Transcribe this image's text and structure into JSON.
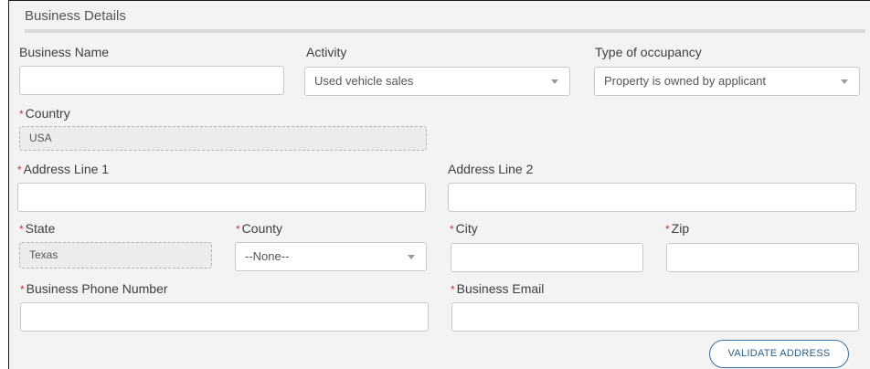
{
  "section": {
    "title": "Business Details"
  },
  "fields": {
    "business_name": {
      "label": "Business Name",
      "value": ""
    },
    "activity": {
      "label": "Activity",
      "value": "Used vehicle sales"
    },
    "occupancy": {
      "label": "Type of occupancy",
      "value": "Property is owned by applicant"
    },
    "country": {
      "label": "Country",
      "required_mark": "*",
      "value": "USA"
    },
    "address1": {
      "label": "Address Line 1",
      "required_mark": "*",
      "value": ""
    },
    "address2": {
      "label": "Address Line 2",
      "value": ""
    },
    "state": {
      "label": "State",
      "required_mark": "*",
      "value": "Texas"
    },
    "county": {
      "label": "County",
      "required_mark": "*",
      "value": "--None--"
    },
    "city": {
      "label": "City",
      "required_mark": "*",
      "value": ""
    },
    "zip": {
      "label": "Zip",
      "required_mark": "*",
      "value": ""
    },
    "phone": {
      "label": "Business Phone Number",
      "required_mark": "*",
      "value": ""
    },
    "email": {
      "label": "Business Email",
      "required_mark": "*",
      "value": ""
    }
  },
  "actions": {
    "validate_label": "VALIDATE ADDRESS"
  },
  "colors": {
    "required": "#c23934",
    "button_border": "#3b6fa0",
    "panel_bg": "#f3f3f3"
  },
  "icons": {
    "dropdown": "chevron-down-icon"
  }
}
